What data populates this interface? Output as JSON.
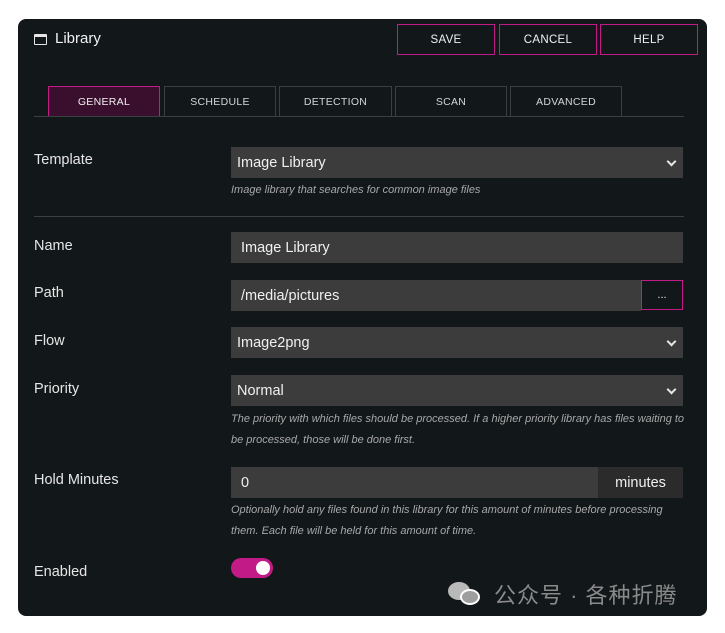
{
  "window": {
    "title": "Library"
  },
  "toolbar": {
    "save_label": "SAVE",
    "cancel_label": "CANCEL",
    "help_label": "HELP"
  },
  "tabs": [
    {
      "label": "GENERAL",
      "active": true
    },
    {
      "label": "SCHEDULE",
      "active": false
    },
    {
      "label": "DETECTION",
      "active": false
    },
    {
      "label": "SCAN",
      "active": false
    },
    {
      "label": "ADVANCED",
      "active": false
    }
  ],
  "form": {
    "template": {
      "label": "Template",
      "value": "Image Library",
      "help": "Image library that searches for common image files"
    },
    "name": {
      "label": "Name",
      "value": "Image Library"
    },
    "path": {
      "label": "Path",
      "value": "/media/pictures",
      "browse_label": "..."
    },
    "flow": {
      "label": "Flow",
      "value": "Image2png"
    },
    "priority": {
      "label": "Priority",
      "value": "Normal",
      "help": "The priority with which files should be processed. If a higher priority library has files waiting to be processed, those will be done first."
    },
    "hold_minutes": {
      "label": "Hold Minutes",
      "value": "0",
      "suffix": "minutes",
      "help": "Optionally hold any files found in this library for this amount of minutes before processing them.  Each file will be held for this amount of time."
    },
    "enabled": {
      "label": "Enabled",
      "value": true
    }
  },
  "watermark": {
    "text": "公众号 · 各种折腾"
  },
  "colors": {
    "accent": "#c21a86",
    "background": "#121719",
    "field": "#3c3c3c",
    "active_tab": "#3a0f2e"
  }
}
